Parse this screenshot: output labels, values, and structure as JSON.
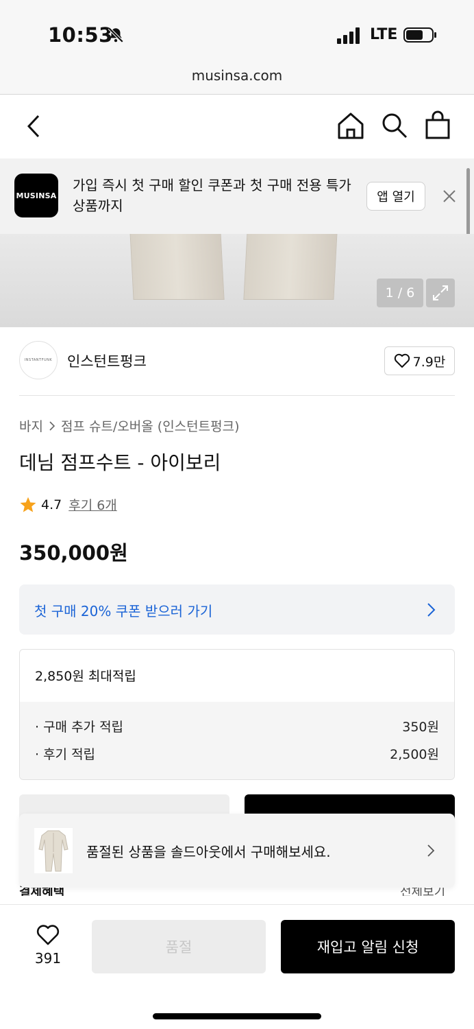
{
  "status_bar": {
    "time": "10:53",
    "network": "LTE"
  },
  "browser": {
    "url": "musinsa.com"
  },
  "app_banner": {
    "logo_text": "MUSINSA",
    "message": "가입 즉시 첫 구매 할인 쿠폰과 첫 구매 전용 특가 상품까지",
    "open_label": "앱 열기"
  },
  "gallery": {
    "counter": "1 / 6"
  },
  "brand": {
    "logo_text": "INSTANTFUNK",
    "name": "인스턴트펑크",
    "likes": "7.9만"
  },
  "product": {
    "breadcrumb": [
      "바지",
      "점프 슈트/오버올 (인스턴트펑크)"
    ],
    "title": "데님 점프수트 - 아이보리",
    "rating": "4.7",
    "review_link": "후기 6개",
    "price": "350,000원"
  },
  "coupon": {
    "label": "첫 구매 20% 쿠폰 받으러 가기"
  },
  "points": {
    "header": "2,850원 최대적립",
    "rows": [
      {
        "label": "· 구매 추가 적립",
        "value": "350원"
      },
      {
        "label": "· 후기 적립",
        "value": "2,500원"
      }
    ]
  },
  "partial": {
    "left": "결제혜택",
    "right": "전체보기"
  },
  "toast": {
    "message": "품절된 상품을 솔드아웃에서 구매해보세요."
  },
  "bottom_bar": {
    "wish_count": "391",
    "soldout_label": "품절",
    "restock_label": "재입고 알림 신청"
  },
  "colors": {
    "accent_blue": "#1a63d6",
    "primary": "#000000"
  }
}
